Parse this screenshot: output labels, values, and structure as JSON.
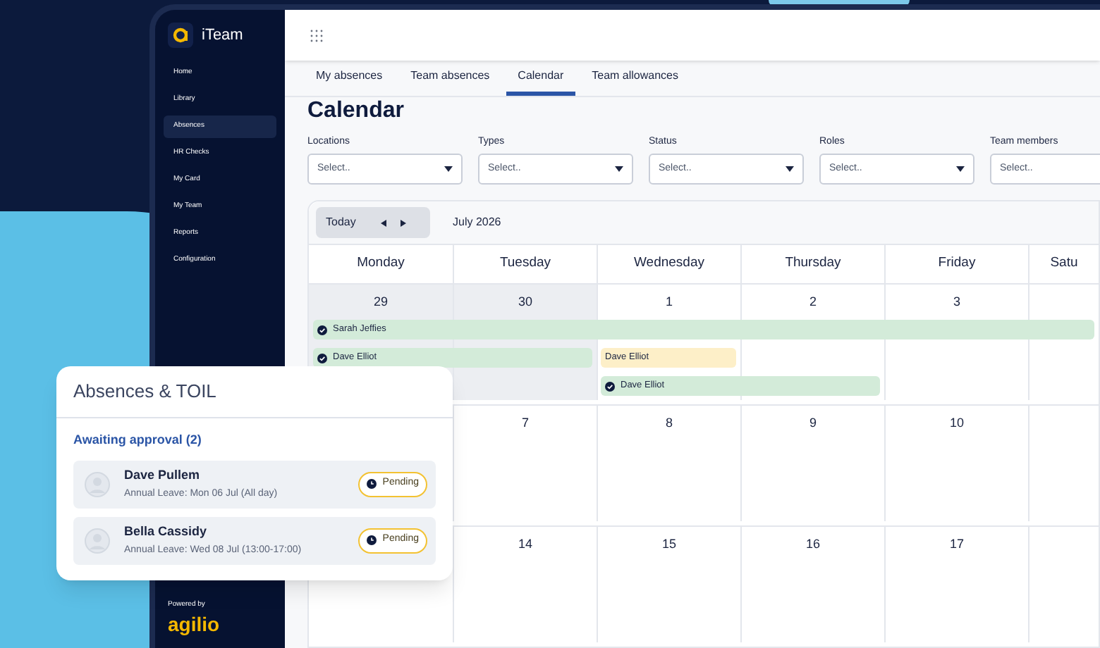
{
  "app": {
    "name": "iTeam"
  },
  "sidebar": {
    "items": [
      {
        "label": "Home",
        "selected": false
      },
      {
        "label": "Library",
        "selected": false
      },
      {
        "label": "Absences",
        "selected": true
      },
      {
        "label": "HR Checks",
        "selected": false
      },
      {
        "label": "My Card",
        "selected": false
      },
      {
        "label": "My Team",
        "selected": false
      },
      {
        "label": "Reports",
        "selected": false
      },
      {
        "label": "Configuration",
        "selected": false
      }
    ],
    "footer": {
      "powered_by": "Powered by",
      "brand": "agilio"
    }
  },
  "tabs": [
    {
      "label": "My absences",
      "selected": false
    },
    {
      "label": "Team absences",
      "selected": false
    },
    {
      "label": "Calendar",
      "selected": true
    },
    {
      "label": "Team allowances",
      "selected": false
    }
  ],
  "page_title": "Calendar",
  "filters": [
    {
      "label": "Locations",
      "placeholder": "Select.."
    },
    {
      "label": "Types",
      "placeholder": "Select.."
    },
    {
      "label": "Status",
      "placeholder": "Select.."
    },
    {
      "label": "Roles",
      "placeholder": "Select.."
    },
    {
      "label": "Team members",
      "placeholder": "Select.."
    }
  ],
  "calendar": {
    "today_button": "Today",
    "month": "July 2026",
    "days": [
      "Monday",
      "Tuesday",
      "Wednesday",
      "Thursday",
      "Friday",
      "Satu"
    ],
    "weeks": [
      {
        "dates": [
          {
            "kind": "date",
            "label": "29",
            "other_month": true
          },
          {
            "kind": "date",
            "label": "30",
            "other_month": true
          },
          {
            "kind": "date",
            "label": "1",
            "other_month": false
          },
          {
            "kind": "date",
            "label": "2",
            "other_month": false
          },
          {
            "kind": "date",
            "label": "3",
            "other_month": false
          },
          {
            "kind": "blank",
            "other_month": false
          }
        ],
        "lanes": [
          [
            {
              "kind": "start",
              "name": "Sarah Jeffies",
              "approved": true
            },
            {
              "kind": "continue"
            },
            {
              "kind": "continue"
            },
            {
              "kind": "continue"
            },
            {
              "kind": "continue"
            },
            {
              "kind": "continue"
            }
          ],
          [
            {
              "kind": "start",
              "name": "Dave Elliot",
              "approved": true
            },
            {
              "kind": "continue"
            },
            {
              "kind": "start",
              "name": "Dave Elliot",
              "approved": false
            },
            {
              "kind": "empty"
            },
            {
              "kind": "empty"
            },
            {
              "kind": "empty"
            }
          ],
          [
            {
              "kind": "empty"
            },
            {
              "kind": "empty"
            },
            {
              "kind": "start",
              "name": "Dave Elliot",
              "approved": true
            },
            {
              "kind": "continue"
            },
            {
              "kind": "empty"
            },
            {
              "kind": "empty"
            }
          ]
        ]
      },
      {
        "dates": [
          {
            "kind": "blank"
          },
          {
            "kind": "date",
            "label": "7"
          },
          {
            "kind": "date",
            "label": "8"
          },
          {
            "kind": "date",
            "label": "9"
          },
          {
            "kind": "date",
            "label": "10"
          },
          {
            "kind": "blank"
          }
        ]
      },
      {
        "dates": [
          {
            "kind": "blank"
          },
          {
            "kind": "date",
            "label": "14"
          },
          {
            "kind": "date",
            "label": "15"
          },
          {
            "kind": "date",
            "label": "16"
          },
          {
            "kind": "date",
            "label": "17"
          },
          {
            "kind": "blank"
          }
        ]
      }
    ]
  },
  "absences_card": {
    "title": "Absences & TOIL",
    "section": "Awaiting approval (2)",
    "requests": [
      {
        "name": "Dave Pullem",
        "detail": "Annual Leave: Mon 06 Jul (All day)",
        "status": "Pending"
      },
      {
        "name": "Bella Cassidy",
        "detail": "Annual Leave: Wed 08 Jul (13:00-17:00)",
        "status": "Pending"
      }
    ]
  }
}
